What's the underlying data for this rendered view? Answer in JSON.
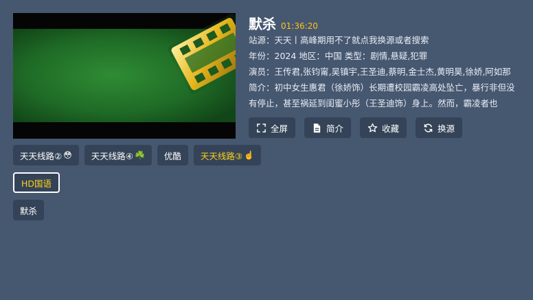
{
  "detail": {
    "title": "默杀",
    "duration": "01:36:20",
    "source_line": "站源：天天丨高峰期用不了就点我换源或者搜索",
    "meta_line": "年份：2024  地区：中国  类型：剧情,悬疑,犯罪",
    "actors_line": "演员：王传君,张钧甯,吴镇宇,王圣迪,蔡明,金士杰,黄明昊,徐娇,阿如那",
    "intro_line": "简介：初中女生惠君（徐娇饰）长期遭校园霸凌高处坠亡，暴行非但没有停止，甚至祸延到闺蜜小彤（王圣迪饰）身上。然而，霸凌者也"
  },
  "actions": [
    {
      "label": "全屏",
      "icon": "fullscreen-icon"
    },
    {
      "label": "简介",
      "icon": "document-icon"
    },
    {
      "label": "收藏",
      "icon": "star-icon"
    },
    {
      "label": "换源",
      "icon": "refresh-icon"
    }
  ],
  "sources": [
    {
      "label": "天天线路②",
      "emoji": "😳"
    },
    {
      "label": "天天线路④",
      "emoji": "☘️"
    },
    {
      "label": "优酷",
      "emoji": ""
    },
    {
      "label": "天天线路③",
      "emoji": "☝️"
    }
  ],
  "qualities": [
    {
      "label": "HD国语"
    }
  ],
  "episodes": [
    {
      "label": "默杀"
    }
  ],
  "colors": {
    "background": "#465770",
    "button": "#344357",
    "accent": "#ffd21a"
  }
}
